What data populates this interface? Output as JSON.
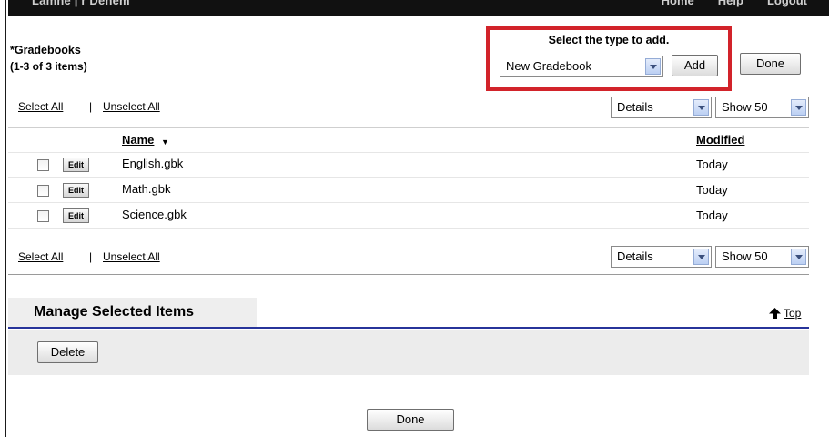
{
  "topbar": {
    "crumb": "Lamne | r Denem",
    "links": [
      "Home",
      "Help",
      "Logout"
    ]
  },
  "header": {
    "title": "*Gradebooks",
    "count": "(1-3 of 3 items)"
  },
  "add_panel": {
    "label": "Select the type to add.",
    "type_select": "New Gradebook",
    "add_button": "Add"
  },
  "done_top": "Done",
  "selection": {
    "select_all": "Select All",
    "separator": "|",
    "unselect_all": "Unselect All"
  },
  "view": {
    "mode": "Details",
    "page_size": "Show 50"
  },
  "table": {
    "columns": {
      "name": "Name",
      "modified": "Modified"
    },
    "edit_label": "Edit",
    "rows": [
      {
        "name": "English.gbk",
        "modified": "Today"
      },
      {
        "name": "Math.gbk",
        "modified": "Today"
      },
      {
        "name": "Science.gbk",
        "modified": "Today"
      }
    ]
  },
  "manage": {
    "title": "Manage Selected Items",
    "top_link": "Top",
    "delete_button": "Delete"
  },
  "done_bottom": "Done",
  "colors": {
    "highlight_border": "#d2232a",
    "section_rule": "#27349a",
    "topbar_bg": "#111111"
  },
  "icons": [
    "chevron-down-icon",
    "sort-desc-icon",
    "up-arrow-icon"
  ]
}
